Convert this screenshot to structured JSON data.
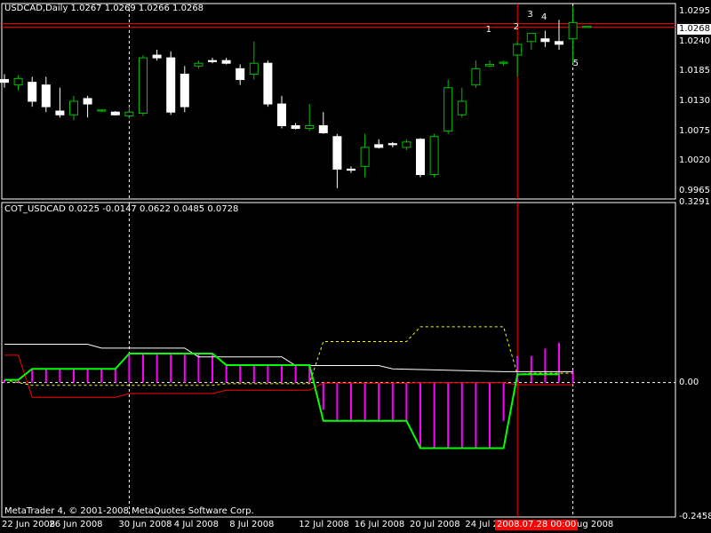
{
  "window": {
    "price_title": "USDCAD,Daily  1.0267 1.0269 1.0266 1.0268",
    "indicator_title": "COT_USDCAD 0.0225 -0.0147 0.0622 0.0485 0.0728",
    "copyright": "MetaTrader 4, © 2001-2008 MetaQuotes Software Corp."
  },
  "colors": {
    "background": "#000000",
    "bull_candle": "#00c000",
    "bear_candle": "#ffffff",
    "hline_red": "#ff0000",
    "histogram": "#ff00ff",
    "green_line": "#00ff00",
    "yellow_dashed": "#ffff00",
    "white_line": "#ffffff",
    "red_line": "#ff0000",
    "grid": "#ffffff"
  },
  "chart_data": [
    {
      "type": "candlestick",
      "title": "USDCAD,Daily",
      "ylim": [
        0.995,
        1.031
      ],
      "y_ticks": [
        "1.0295",
        "1.0240",
        "1.0185",
        "1.0130",
        "1.0075",
        "1.0020",
        "0.9965"
      ],
      "current_price": "1.0268",
      "x_ticks": [
        "22 Jun 2008",
        "26 Jun 2008",
        "30 Jun 2008",
        "4 Jul 2008",
        "8 Jul 2008",
        "12 Jul 2008",
        "16 Jul 2008",
        "20 Jul 2008",
        "24 Jul 2008",
        "1 Aug 2008"
      ],
      "highlighted_date": "2008.07.28 00:00",
      "point_labels": [
        "1",
        "2",
        "3",
        "4",
        "5"
      ],
      "candles": [
        [
          1.017,
          1.018,
          1.0155,
          1.0165
        ],
        [
          1.016,
          1.0178,
          1.015,
          1.0172
        ],
        [
          1.0165,
          1.0175,
          1.012,
          1.013
        ],
        [
          1.016,
          1.0175,
          1.011,
          1.012
        ],
        [
          1.0112,
          1.0155,
          1.01,
          1.0105
        ],
        [
          1.0105,
          1.014,
          1.0095,
          1.013
        ],
        [
          1.0135,
          1.014,
          1.01,
          1.0125
        ],
        [
          1.0112,
          1.0115,
          1.011,
          1.0114
        ],
        [
          1.011,
          1.0112,
          1.0104,
          1.0105
        ],
        [
          1.0103,
          1.012,
          1.0098,
          1.011
        ],
        [
          1.0108,
          1.0215,
          1.0103,
          1.021
        ],
        [
          1.0215,
          1.0225,
          1.0205,
          1.021
        ],
        [
          1.021,
          1.0222,
          1.0105,
          1.011
        ],
        [
          1.018,
          1.0195,
          1.011,
          1.012
        ],
        [
          1.0195,
          1.0205,
          1.019,
          1.02
        ],
        [
          1.0205,
          1.021,
          1.02,
          1.0203
        ],
        [
          1.0205,
          1.021,
          1.0198,
          1.02
        ],
        [
          1.019,
          1.0198,
          1.016,
          1.017
        ],
        [
          1.018,
          1.024,
          1.017,
          1.02
        ],
        [
          1.02,
          1.0205,
          1.012,
          1.0125
        ],
        [
          1.0125,
          1.014,
          1.008,
          1.0085
        ],
        [
          1.0085,
          1.009,
          1.0078,
          1.008
        ],
        [
          1.008,
          1.0125,
          1.0075,
          1.0085
        ],
        [
          1.0085,
          1.011,
          1.007,
          1.0072
        ],
        [
          1.0065,
          1.007,
          0.997,
          1.0005
        ],
        [
          1.0005,
          1.001,
          0.9998,
          1.0003
        ],
        [
          1.001,
          1.007,
          0.999,
          1.0045
        ],
        [
          1.005,
          1.006,
          1.0043,
          1.0045
        ],
        [
          1.0052,
          1.0055,
          1.0045,
          1.005
        ],
        [
          1.0045,
          1.006,
          1.004,
          1.0055
        ],
        [
          1.006,
          1.0062,
          0.999,
          0.9995
        ],
        [
          0.9995,
          1.007,
          0.999,
          1.0065
        ],
        [
          1.0075,
          1.017,
          1.007,
          1.0155
        ],
        [
          1.0105,
          1.0155,
          1.01,
          1.013
        ],
        [
          1.016,
          1.0205,
          1.0155,
          1.019
        ],
        [
          1.0195,
          1.0205,
          1.0193,
          1.0198
        ],
        [
          1.02,
          1.0205,
          1.0195,
          1.0202
        ],
        [
          1.0215,
          1.024,
          1.0175,
          1.0235
        ],
        [
          1.024,
          1.0255,
          1.0225,
          1.0255
        ],
        [
          1.0245,
          1.026,
          1.023,
          1.024
        ],
        [
          1.024,
          1.028,
          1.0225,
          1.0235
        ],
        [
          1.0245,
          1.0305,
          1.02,
          1.0275
        ],
        [
          1.0266,
          1.0269,
          1.0266,
          1.0268
        ]
      ]
    },
    {
      "type": "indicator",
      "title": "COT_USDCAD",
      "values": [
        "0.0225",
        "-0.0147",
        "0.0622",
        "0.0485",
        "0.0728"
      ],
      "ylim": [
        -0.2458,
        0.3291
      ],
      "y_ticks": [
        "0.3291",
        "0.00",
        "-0.2458"
      ],
      "green_line": [
        [
          0,
          0.005
        ],
        [
          1,
          0.005
        ],
        [
          2,
          0.025
        ],
        [
          3,
          0.025
        ],
        [
          4,
          0.025
        ],
        [
          5,
          0.025
        ],
        [
          6,
          0.025
        ],
        [
          7,
          0.025
        ],
        [
          8,
          0.025
        ],
        [
          9,
          0.053
        ],
        [
          10,
          0.053
        ],
        [
          11,
          0.053
        ],
        [
          12,
          0.053
        ],
        [
          13,
          0.053
        ],
        [
          14,
          0.053
        ],
        [
          15,
          0.053
        ],
        [
          16,
          0.032
        ],
        [
          17,
          0.032
        ],
        [
          18,
          0.032
        ],
        [
          19,
          0.032
        ],
        [
          20,
          0.032
        ],
        [
          21,
          0.032
        ],
        [
          22,
          0.032
        ],
        [
          23,
          -0.07
        ],
        [
          24,
          -0.07
        ],
        [
          25,
          -0.07
        ],
        [
          26,
          -0.07
        ],
        [
          27,
          -0.07
        ],
        [
          28,
          -0.07
        ],
        [
          29,
          -0.07
        ],
        [
          30,
          -0.12
        ],
        [
          31,
          -0.12
        ],
        [
          32,
          -0.12
        ],
        [
          33,
          -0.12
        ],
        [
          34,
          -0.12
        ],
        [
          35,
          -0.12
        ],
        [
          36,
          -0.12
        ],
        [
          37,
          0.015
        ],
        [
          38,
          0.015
        ],
        [
          39,
          0.015
        ],
        [
          40,
          0.015
        ]
      ],
      "magenta_bars": [
        [
          0,
          0.005
        ],
        [
          1,
          0.005
        ],
        [
          2,
          0.025
        ],
        [
          3,
          0.025
        ],
        [
          4,
          0.025
        ],
        [
          5,
          0.025
        ],
        [
          6,
          0.025
        ],
        [
          7,
          0.025
        ],
        [
          8,
          0.025
        ],
        [
          9,
          0.053
        ],
        [
          10,
          0.053
        ],
        [
          11,
          0.053
        ],
        [
          12,
          0.053
        ],
        [
          13,
          0.053
        ],
        [
          14,
          0.053
        ],
        [
          15,
          0.053
        ],
        [
          16,
          0.032
        ],
        [
          17,
          0.032
        ],
        [
          18,
          0.032
        ],
        [
          19,
          0.032
        ],
        [
          20,
          0.032
        ],
        [
          21,
          0.032
        ],
        [
          22,
          0.032
        ],
        [
          23,
          -0.05
        ],
        [
          24,
          -0.07
        ],
        [
          25,
          -0.07
        ],
        [
          26,
          -0.07
        ],
        [
          27,
          -0.07
        ],
        [
          28,
          -0.07
        ],
        [
          29,
          -0.07
        ],
        [
          30,
          -0.12
        ],
        [
          31,
          -0.12
        ],
        [
          32,
          -0.12
        ],
        [
          33,
          -0.12
        ],
        [
          34,
          -0.12
        ],
        [
          35,
          -0.12
        ],
        [
          36,
          -0.07
        ],
        [
          37,
          0.0485
        ],
        [
          38,
          0.0485
        ],
        [
          39,
          0.0622
        ],
        [
          40,
          0.0728
        ],
        [
          41,
          0.0225
        ]
      ],
      "yellow_dashed": [
        [
          0,
          0.005
        ],
        [
          2,
          -0.005
        ],
        [
          15,
          -0.005
        ],
        [
          16,
          -0.002
        ],
        [
          22,
          -0.002
        ],
        [
          23,
          0.075
        ],
        [
          29,
          0.075
        ],
        [
          30,
          0.102
        ],
        [
          36,
          0.102
        ],
        [
          37,
          0.015
        ],
        [
          38,
          0.017
        ],
        [
          41,
          0.017
        ]
      ],
      "white_line": [
        [
          0,
          0.07
        ],
        [
          6,
          0.07
        ],
        [
          7,
          0.063
        ],
        [
          13,
          0.063
        ],
        [
          14,
          0.047
        ],
        [
          20,
          0.047
        ],
        [
          21,
          0.031
        ],
        [
          27,
          0.031
        ],
        [
          28,
          0.025
        ],
        [
          36,
          0.02
        ],
        [
          37,
          0.02
        ],
        [
          41,
          0.02
        ]
      ],
      "red_line": [
        [
          0,
          0.05
        ],
        [
          1,
          0.05
        ],
        [
          2,
          -0.027
        ],
        [
          8,
          -0.027
        ],
        [
          9,
          -0.02
        ],
        [
          15,
          -0.02
        ],
        [
          16,
          -0.014
        ],
        [
          22,
          -0.014
        ],
        [
          23,
          -0.001
        ],
        [
          29,
          -0.001
        ],
        [
          30,
          0.0
        ],
        [
          36,
          0.0
        ],
        [
          37,
          -0.004
        ],
        [
          41,
          -0.004
        ]
      ]
    }
  ]
}
